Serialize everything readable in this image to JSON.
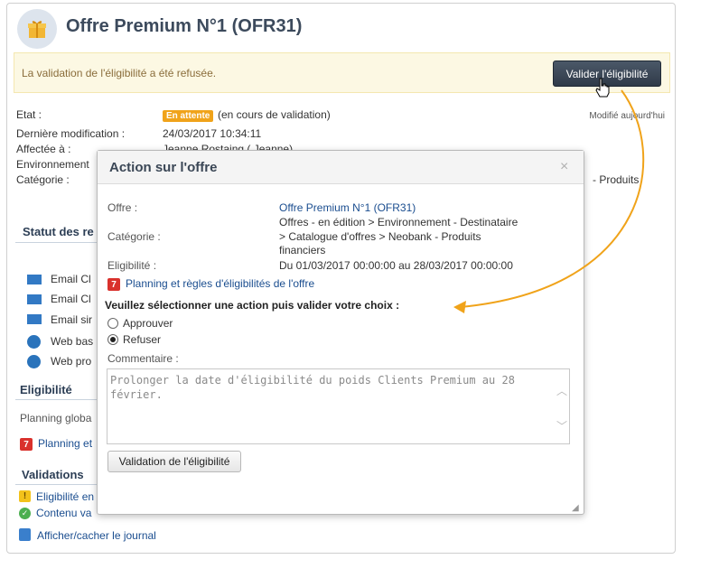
{
  "header": {
    "title": "Offre Premium N°1 (OFR31)",
    "icon": "gift-icon"
  },
  "banner": {
    "message": "La validation de l'éligibilité a été refusée.",
    "button_label": "Valider l'éligibilité"
  },
  "details": {
    "etat_label": "Etat :",
    "etat_badge": "En attente",
    "etat_text": "(en cours de validation)",
    "modified": "Modifié aujourd'hui",
    "last_mod_label": "Dernière modification :",
    "last_mod_value": "24/03/2017 10:34:11",
    "assigned_label": "Affectée à :",
    "assigned_value": "Jeanne Rostaing ( Jeanne)",
    "env_label": "Environnement",
    "cat_label": "Catégorie :",
    "cat_tail": "- Produits"
  },
  "sections": {
    "statut_title": "Statut des re",
    "statut_items": [
      "Email Cl",
      "Email Cl",
      "Email sir",
      "Web bas",
      "Web pro"
    ],
    "eligibilite_title": "Eligibilité",
    "planning_text": "Planning globa",
    "planning_link": "Planning et",
    "validations_title": "Validations",
    "validation_items": [
      "Eligibilité en",
      "Contenu va"
    ],
    "journal_link": "Afficher/cacher le journal"
  },
  "modal": {
    "title": "Action sur l'offre",
    "close": "×",
    "offre_label": "Offre :",
    "offre_value": "Offre Premium N°1 (OFR31)",
    "categorie_label": "Catégorie :",
    "categorie_lines": [
      "Offres - en édition > Environnement - Destinataire",
      "> Catalogue d'offres > Neobank - Produits",
      "financiers"
    ],
    "eligibilite_label": "Eligibilité :",
    "eligibilite_value": "Du 01/03/2017 00:00:00 au 28/03/2017 00:00:00",
    "planning_link": "Planning et règles d'éligibilités de l'offre",
    "prompt": "Veuillez sélectionner une action puis valider votre choix :",
    "options": [
      "Approuver",
      "Refuser"
    ],
    "selected": "Refuser",
    "comment_label": "Commentaire :",
    "comment_value": "Prolonger la date d'éligibilité du poids Clients Premium au 28 février.",
    "submit_label": "Validation de l'éligibilité"
  },
  "colors": {
    "accent_orange": "#f0a31a",
    "link_blue": "#1a4d8f",
    "dark_button": "#2f3a48"
  }
}
